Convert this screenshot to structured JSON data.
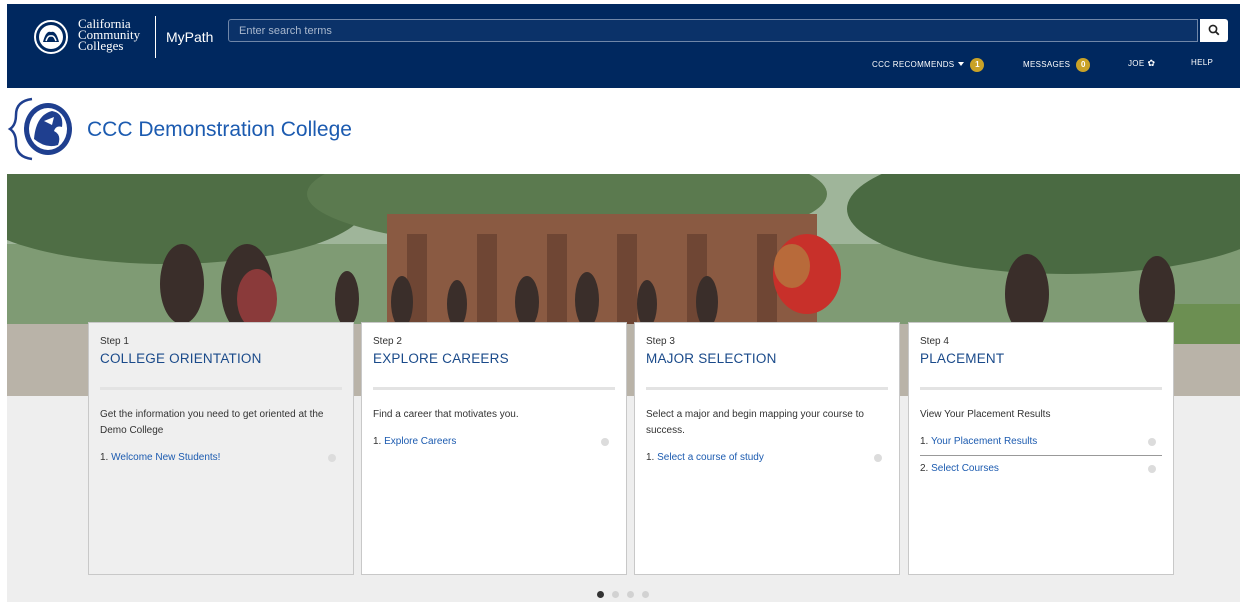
{
  "header": {
    "logo_lines": [
      "California",
      "Community",
      "Colleges"
    ],
    "app_name": "MyPath",
    "search_placeholder": "Enter search terms",
    "nav": {
      "recommends_label": "CCC RECOMMENDS",
      "recommends_count": "1",
      "messages_label": "MESSAGES",
      "messages_count": "0",
      "user_label": "JOE",
      "help_label": "HELP"
    }
  },
  "college": {
    "name": "CCC Demonstration College"
  },
  "steps": [
    {
      "label": "Step 1",
      "title": "COLLEGE ORIENTATION",
      "description": "Get the information you need to get oriented at the Demo College",
      "tasks": [
        {
          "num": "1.",
          "text": "Welcome New Students!"
        }
      ]
    },
    {
      "label": "Step 2",
      "title": "EXPLORE CAREERS",
      "description": "Find a career that motivates you.",
      "tasks": [
        {
          "num": "1.",
          "text": "Explore Careers"
        }
      ]
    },
    {
      "label": "Step 3",
      "title": "MAJOR SELECTION",
      "description": "Select a major and begin mapping your course to success.",
      "tasks": [
        {
          "num": "1.",
          "text": "Select a course of study"
        }
      ]
    },
    {
      "label": "Step 4",
      "title": "PLACEMENT",
      "description": "View Your Placement Results",
      "tasks": [
        {
          "num": "1.",
          "text": "Your Placement Results"
        },
        {
          "num": "2.",
          "text": "Select Courses"
        }
      ]
    }
  ],
  "carousel": {
    "pages": 4,
    "active": 1
  },
  "colors": {
    "navy": "#00285f",
    "link_blue": "#1c5bb0",
    "badge_gold": "#c9a227"
  }
}
